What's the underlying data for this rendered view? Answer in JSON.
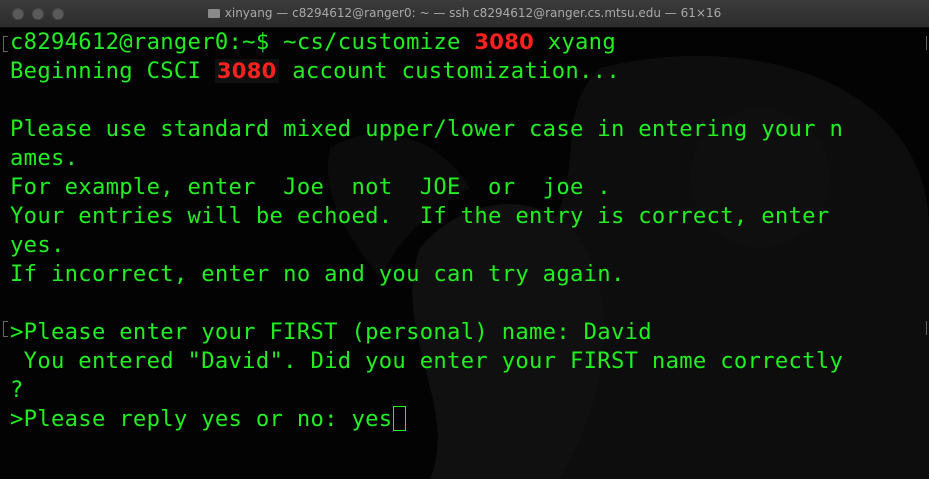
{
  "window": {
    "title": "xinyang — c8294612@ranger0: ~ — ssh c8294612@ranger.cs.mtsu.edu — 61×16"
  },
  "terminal": {
    "line1_prompt": "c8294612@ranger0:~$ ~cs/customize ",
    "line1_course": "3080",
    "line1_user": " xyang",
    "line2_pre": "Beginning CSCI ",
    "line2_course": "3080",
    "line2_post": " account customization...",
    "line4": "Please use standard mixed upper/lower case in entering your n",
    "line5": "ames.",
    "line6": "For example, enter  Joe  not  JOE  or  joe .",
    "line7": "Your entries will be echoed.  If the entry is correct, enter",
    "line8": "yes.",
    "line9": "If incorrect, enter no and you can try again.",
    "line11": ">Please enter your FIRST (personal) name: David",
    "line12": " You entered \"David\". Did you enter your FIRST name correctly",
    "line13": "?",
    "line14": ">Please reply yes or no: yes"
  },
  "colors": {
    "terminal_text": "#22ee22",
    "highlight": "#ff2020",
    "background": "#030303"
  }
}
